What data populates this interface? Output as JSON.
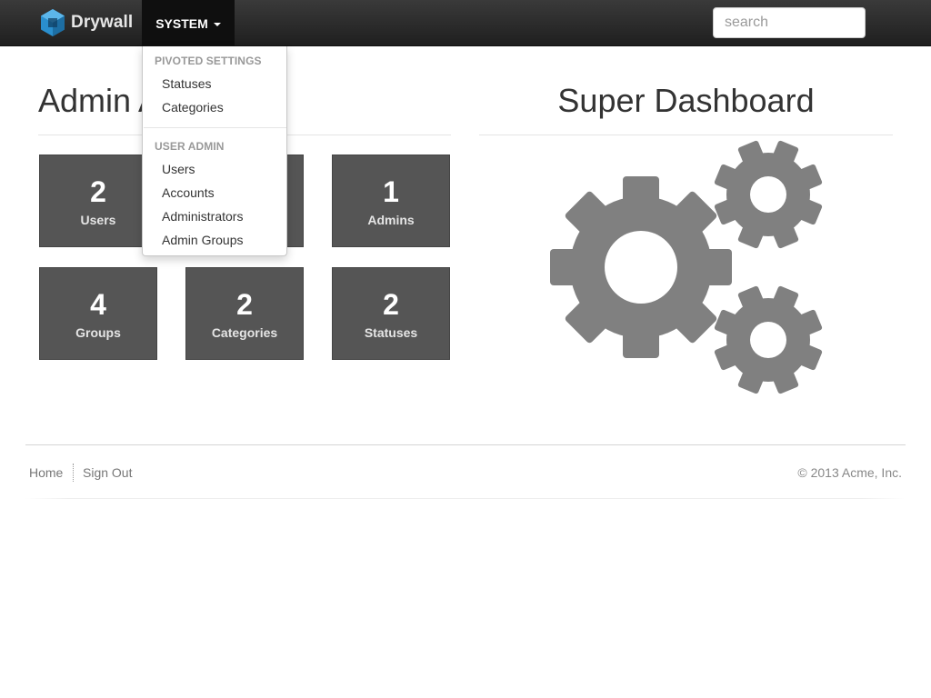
{
  "brand": {
    "name": "Drywall"
  },
  "nav": {
    "system_label": "SYSTEM"
  },
  "search": {
    "placeholder": "search",
    "value": ""
  },
  "dropdown": {
    "sections": [
      {
        "header": "PIVOTED SETTINGS",
        "items": [
          "Statuses",
          "Categories"
        ]
      },
      {
        "header": "USER ADMIN",
        "items": [
          "Users",
          "Accounts",
          "Administrators",
          "Admin Groups"
        ]
      }
    ]
  },
  "main": {
    "left_title": "Admin A",
    "right_title": "Super Dashboard",
    "tiles": [
      {
        "value": "2",
        "label": "Users"
      },
      {
        "value": "",
        "label": ""
      },
      {
        "value": "1",
        "label": "Admins"
      },
      {
        "value": "4",
        "label": "Groups"
      },
      {
        "value": "2",
        "label": "Categories"
      },
      {
        "value": "2",
        "label": "Statuses"
      }
    ]
  },
  "footer": {
    "links": [
      "Home",
      "Sign Out"
    ],
    "copyright": "© 2013 Acme, Inc."
  },
  "colors": {
    "tile": "#555555",
    "gear": "#808080",
    "navbar": "#222222"
  },
  "icons": {
    "logo": "drywall-logo-icon",
    "gears": "gears-icon"
  }
}
